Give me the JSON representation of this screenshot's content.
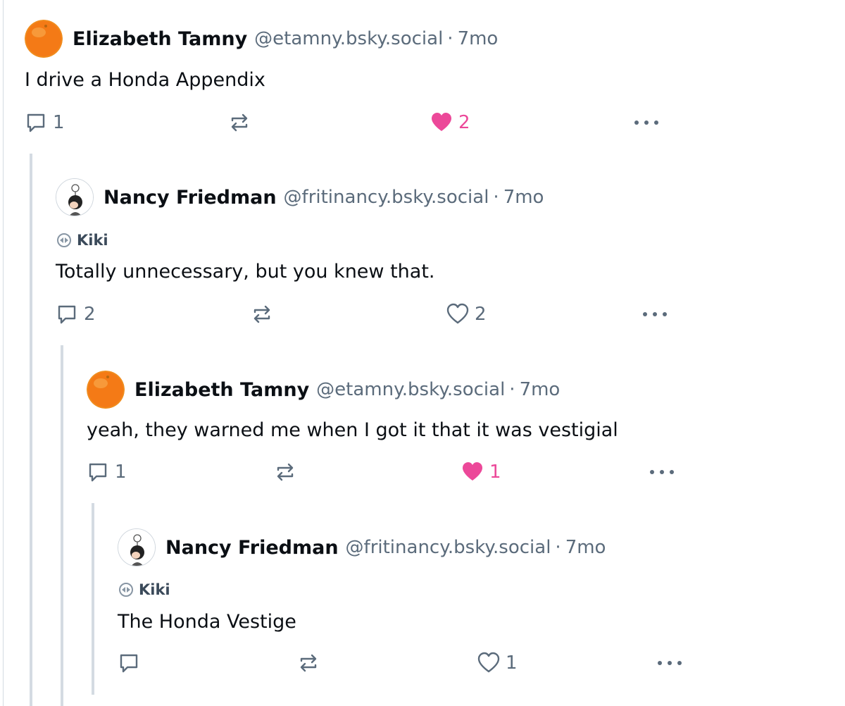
{
  "posts": [
    {
      "author": "Elizabeth Tamny",
      "handle": "@etamny.bsky.social",
      "separator": "·",
      "time": "7mo",
      "text": "I drive a Honda Appendix",
      "label": "",
      "reply_count": "1",
      "like_count": "2",
      "liked": true
    },
    {
      "author": "Nancy Friedman",
      "handle": "@fritinancy.bsky.social",
      "separator": "·",
      "time": "7mo",
      "label": "Kiki",
      "text": "Totally unnecessary, but you knew that.",
      "reply_count": "2",
      "like_count": "2",
      "liked": false
    },
    {
      "author": "Elizabeth Tamny",
      "handle": "@etamny.bsky.social",
      "separator": "·",
      "time": "7mo",
      "text": "yeah, they warned me when I got it that it was vestigial",
      "label": "",
      "reply_count": "1",
      "like_count": "1",
      "liked": true
    },
    {
      "author": "Nancy Friedman",
      "handle": "@fritinancy.bsky.social",
      "separator": "·",
      "time": "7mo",
      "label": "Kiki",
      "text": "The Honda Vestige",
      "reply_count": "",
      "like_count": "1",
      "liked": false
    }
  ],
  "colors": {
    "text": "#0b0f14",
    "muted": "#5b6b7b",
    "like": "#ec4899",
    "thread_line": "#d4dbe2"
  },
  "icons": [
    "reply-icon",
    "repost-icon",
    "heart-icon",
    "more-icon",
    "label-icon"
  ]
}
